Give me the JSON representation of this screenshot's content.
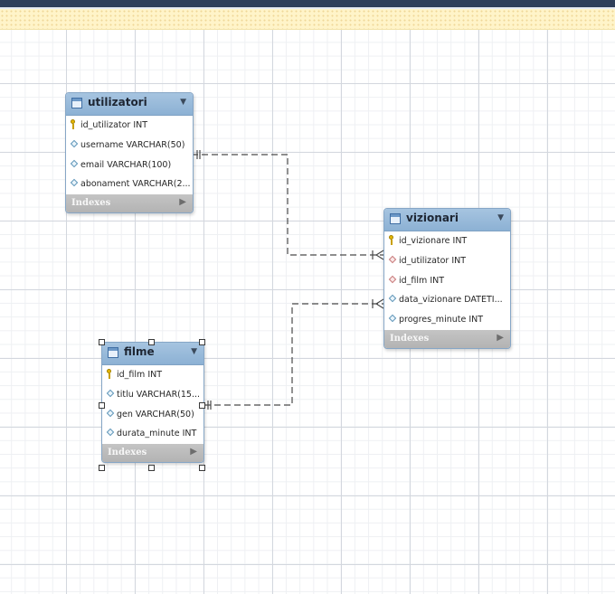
{
  "tables": {
    "utilizatori": {
      "name": "utilizatori",
      "columns": [
        {
          "label": "id_utilizator INT",
          "kind": "primary-key"
        },
        {
          "label": "username VARCHAR(50)",
          "kind": "column"
        },
        {
          "label": "email VARCHAR(100)",
          "kind": "column"
        },
        {
          "label": "abonament VARCHAR(2...",
          "kind": "column"
        }
      ],
      "indexes_label": "Indexes"
    },
    "vizionari": {
      "name": "vizionari",
      "columns": [
        {
          "label": "id_vizionare INT",
          "kind": "primary-key"
        },
        {
          "label": "id_utilizator INT",
          "kind": "foreign-key"
        },
        {
          "label": "id_film INT",
          "kind": "foreign-key"
        },
        {
          "label": "data_vizionare DATETI...",
          "kind": "column"
        },
        {
          "label": "progres_minute INT",
          "kind": "column"
        }
      ],
      "indexes_label": "Indexes"
    },
    "filme": {
      "name": "filme",
      "columns": [
        {
          "label": "id_film INT",
          "kind": "primary-key"
        },
        {
          "label": "titlu VARCHAR(15...",
          "kind": "column"
        },
        {
          "label": "gen VARCHAR(50)",
          "kind": "column"
        },
        {
          "label": "durata_minute INT",
          "kind": "column"
        }
      ],
      "indexes_label": "Indexes"
    }
  },
  "relationships": [
    {
      "from": "utilizatori.id_utilizator",
      "to": "vizionari.id_utilizator",
      "cardinality": "one-to-many",
      "style": "dashed"
    },
    {
      "from": "filme.id_film",
      "to": "vizionari.id_film",
      "cardinality": "one-to-many",
      "style": "dashed"
    }
  ],
  "selection": {
    "selected_table": "filme"
  },
  "colors": {
    "header": "#9bbcdc",
    "indexes_bar": "#bdbdbd",
    "connector": "#4a4a4a",
    "warning_strip": "#fff4c9"
  }
}
